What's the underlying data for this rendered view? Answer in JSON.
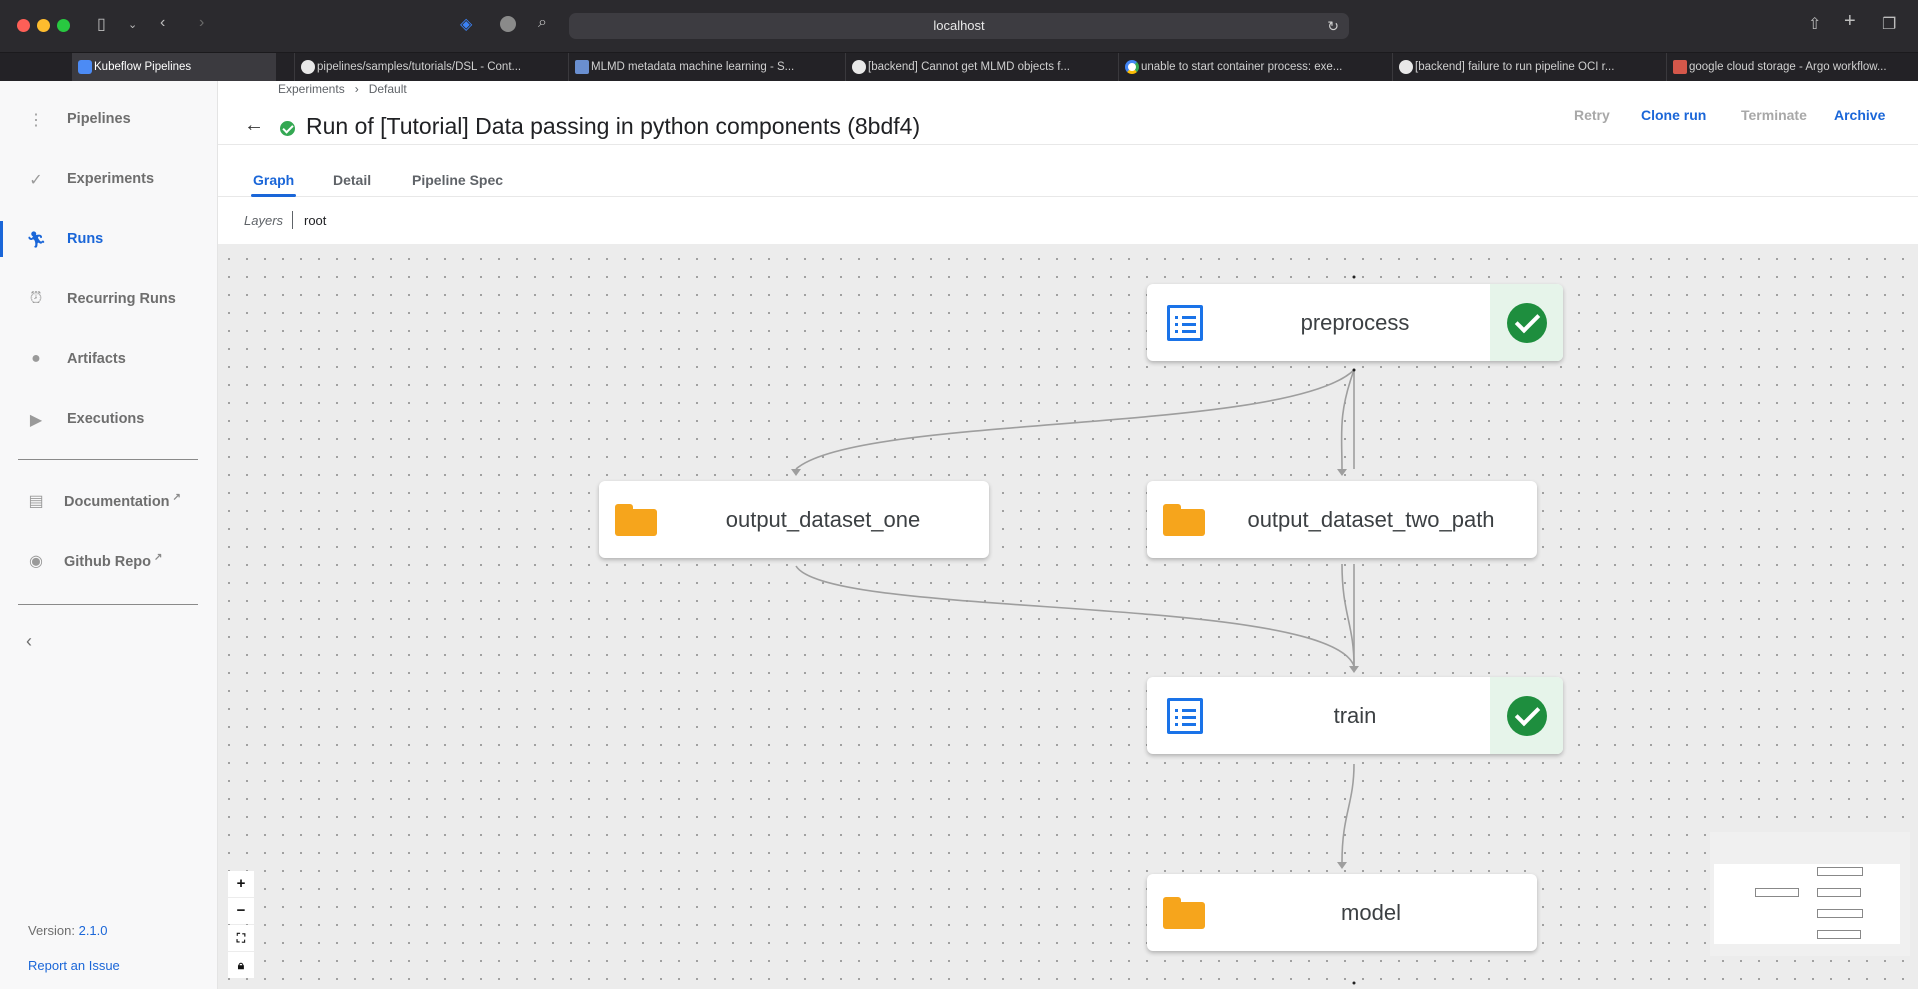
{
  "browser": {
    "url": "localhost",
    "tabs": [
      {
        "title": "Kubeflow Pipelines",
        "favicon": "kubeflow-icon"
      },
      {
        "title": "pipelines/samples/tutorials/DSL - Cont...",
        "favicon": "github-icon"
      },
      {
        "title": "MLMD metadata machine learning - S...",
        "favicon": "search-icon"
      },
      {
        "title": "[backend] Cannot get MLMD objects f...",
        "favicon": "github-icon"
      },
      {
        "title": "unable to start container process: exe...",
        "favicon": "google-icon"
      },
      {
        "title": "[backend] failure to run pipeline OCI r...",
        "favicon": "github-icon"
      },
      {
        "title": "google cloud storage - Argo workflow...",
        "favicon": "stackoverflow-icon"
      }
    ]
  },
  "sidebar": {
    "items": [
      {
        "label": "Pipelines",
        "icon": "pipelines-icon"
      },
      {
        "label": "Experiments",
        "icon": "experiments-icon"
      },
      {
        "label": "Runs",
        "icon": "runs-icon",
        "active": true
      },
      {
        "label": "Recurring Runs",
        "icon": "alarm-icon"
      },
      {
        "label": "Artifacts",
        "icon": "artifacts-icon"
      },
      {
        "label": "Executions",
        "icon": "play-icon"
      }
    ],
    "links": [
      {
        "label": "Documentation",
        "icon": "document-icon"
      },
      {
        "label": "Github Repo",
        "icon": "github-icon"
      }
    ],
    "version_label": "Version: ",
    "version": "2.1.0",
    "report": "Report an Issue"
  },
  "header": {
    "breadcrumb": [
      "Experiments",
      "Default"
    ],
    "title": "Run of [Tutorial] Data passing in python components (8bdf4)",
    "buttons": {
      "retry": "Retry",
      "clone": "Clone run",
      "terminate": "Terminate",
      "archive": "Archive"
    }
  },
  "tabs": [
    "Graph",
    "Detail",
    "Pipeline Spec"
  ],
  "layers": {
    "label": "Layers",
    "current": "root"
  },
  "graph": {
    "nodes": [
      {
        "id": "preprocess",
        "label": "preprocess",
        "kind": "execution",
        "status": "succeeded"
      },
      {
        "id": "output_dataset_one",
        "label": "output_dataset_one",
        "kind": "artifact"
      },
      {
        "id": "output_dataset_two_path",
        "label": "output_dataset_two_path",
        "kind": "artifact"
      },
      {
        "id": "train",
        "label": "train",
        "kind": "execution",
        "status": "succeeded"
      },
      {
        "id": "model",
        "label": "model",
        "kind": "artifact"
      }
    ],
    "edges": [
      [
        "preprocess",
        "output_dataset_one"
      ],
      [
        "preprocess",
        "output_dataset_two_path"
      ],
      [
        "output_dataset_one",
        "train"
      ],
      [
        "output_dataset_two_path",
        "train"
      ],
      [
        "train",
        "model"
      ]
    ]
  },
  "colors": {
    "accent": "#1a66d8",
    "success": "#1e8e3e",
    "artifact": "#f6a51c"
  }
}
